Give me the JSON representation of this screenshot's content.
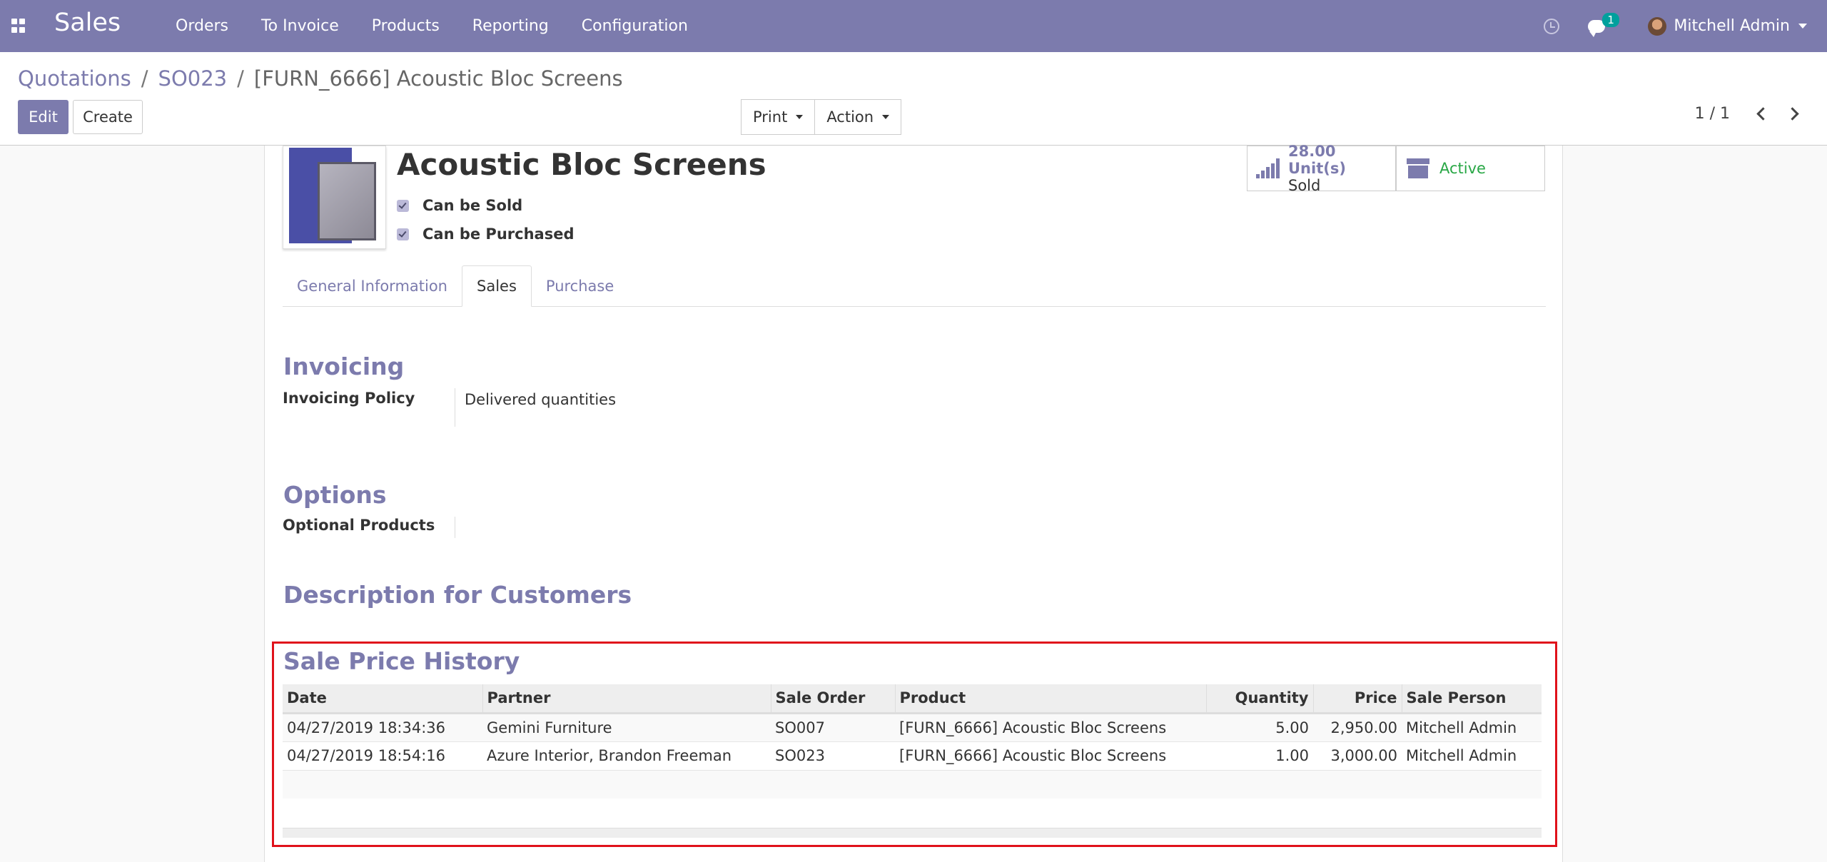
{
  "navbar": {
    "brand": "Sales",
    "menu": [
      "Orders",
      "To Invoice",
      "Products",
      "Reporting",
      "Configuration"
    ],
    "chat_count": "1",
    "user_name": "Mitchell Admin",
    "color": "#7c7bad"
  },
  "control": {
    "breadcrumb": [
      "Quotations",
      "SO023",
      "[FURN_6666] Acoustic Bloc Screens"
    ],
    "edit_label": "Edit",
    "create_label": "Create",
    "print_label": "Print",
    "action_label": "Action",
    "pager": "1 / 1"
  },
  "product": {
    "name": "Acoustic Bloc Screens",
    "can_be_sold": "Can be Sold",
    "can_be_purchased": "Can be Purchased",
    "sold_value": "28.00 Unit(s)",
    "sold_label": "Sold",
    "active_label": "Active"
  },
  "tabs": [
    "General Information",
    "Sales",
    "Purchase"
  ],
  "invoicing": {
    "title": "Invoicing",
    "policy_label": "Invoicing Policy",
    "policy_value": "Delivered quantities"
  },
  "options": {
    "title": "Options",
    "optional_label": "Optional Products"
  },
  "description": {
    "title": "Description for Customers"
  },
  "history": {
    "title": "Sale Price History",
    "columns": [
      "Date",
      "Partner",
      "Sale Order",
      "Product",
      "Quantity",
      "Price",
      "Sale Person"
    ],
    "rows": [
      [
        "04/27/2019 18:34:36",
        "Gemini Furniture",
        "SO007",
        "[FURN_6666] Acoustic Bloc Screens",
        "5.00",
        "2,950.00",
        "Mitchell Admin"
      ],
      [
        "04/27/2019 18:54:16",
        "Azure Interior, Brandon Freeman",
        "SO023",
        "[FURN_6666] Acoustic Bloc Screens",
        "1.00",
        "3,000.00",
        "Mitchell Admin"
      ]
    ]
  }
}
